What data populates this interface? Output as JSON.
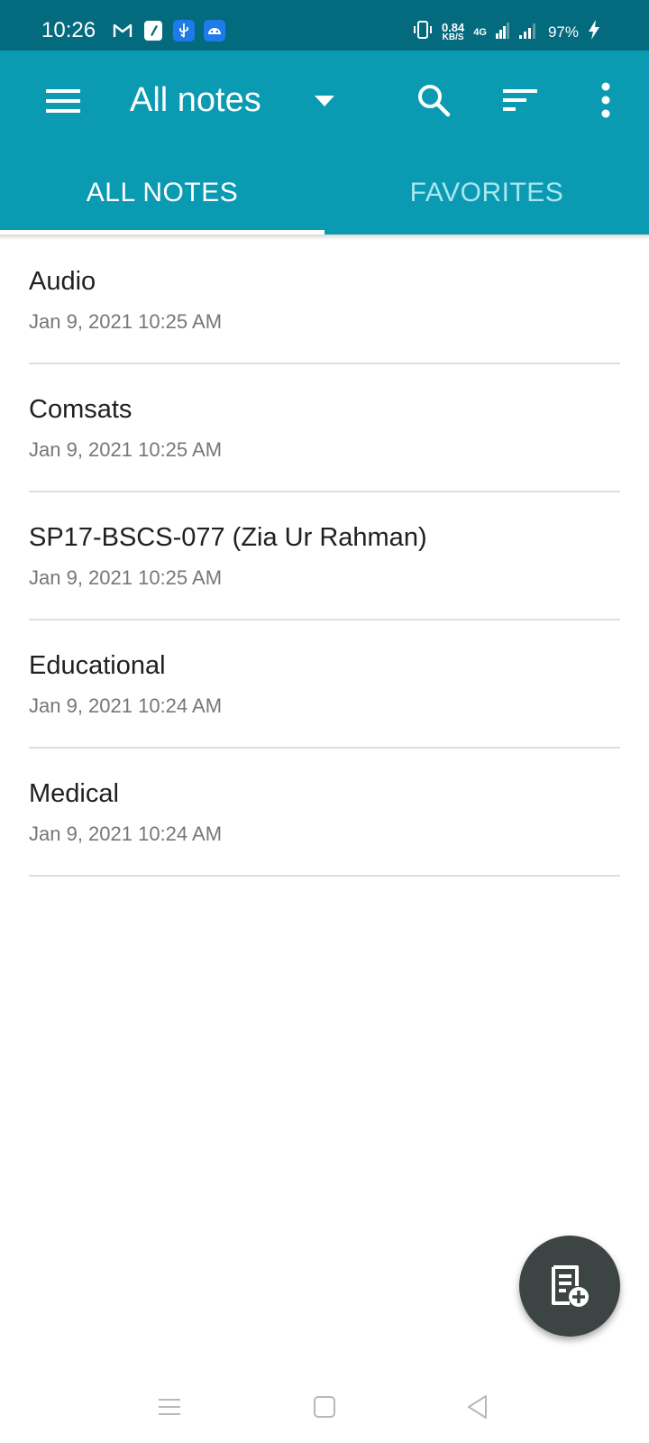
{
  "status_bar": {
    "time": "10:26",
    "net_speed": "0.84",
    "net_unit": "KB/S",
    "network_type": "4G",
    "battery": "97%",
    "notification_icons": [
      "gmail-icon",
      "notes-app-icon",
      "usb-icon",
      "android-debug-icon"
    ]
  },
  "toolbar": {
    "title": "All notes",
    "icons": [
      "menu-icon",
      "dropdown-arrow-icon",
      "search-icon",
      "sort-icon",
      "more-vert-icon"
    ]
  },
  "tabs": [
    {
      "label": "ALL NOTES",
      "active": true
    },
    {
      "label": "FAVORITES",
      "active": false
    }
  ],
  "notes": [
    {
      "title": "Audio",
      "date": "Jan 9, 2021 10:25 AM"
    },
    {
      "title": "Comsats",
      "date": "Jan 9, 2021 10:25 AM"
    },
    {
      "title": "SP17-BSCS-077 (Zia Ur Rahman)",
      "date": "Jan 9, 2021 10:25 AM"
    },
    {
      "title": "Educational",
      "date": "Jan 9, 2021 10:24 AM"
    },
    {
      "title": "Medical",
      "date": "Jan 9, 2021 10:24 AM"
    }
  ],
  "fab": {
    "icon": "add-note-icon"
  },
  "nav_bar": {
    "icons": [
      "recents-icon",
      "home-icon",
      "back-icon"
    ]
  },
  "colors": {
    "status_bar": "#046a7d",
    "app_bar": "#0a9bb3",
    "inactive_tab": "#a9e6ef",
    "fab": "#3d4544",
    "divider": "#dedede"
  }
}
